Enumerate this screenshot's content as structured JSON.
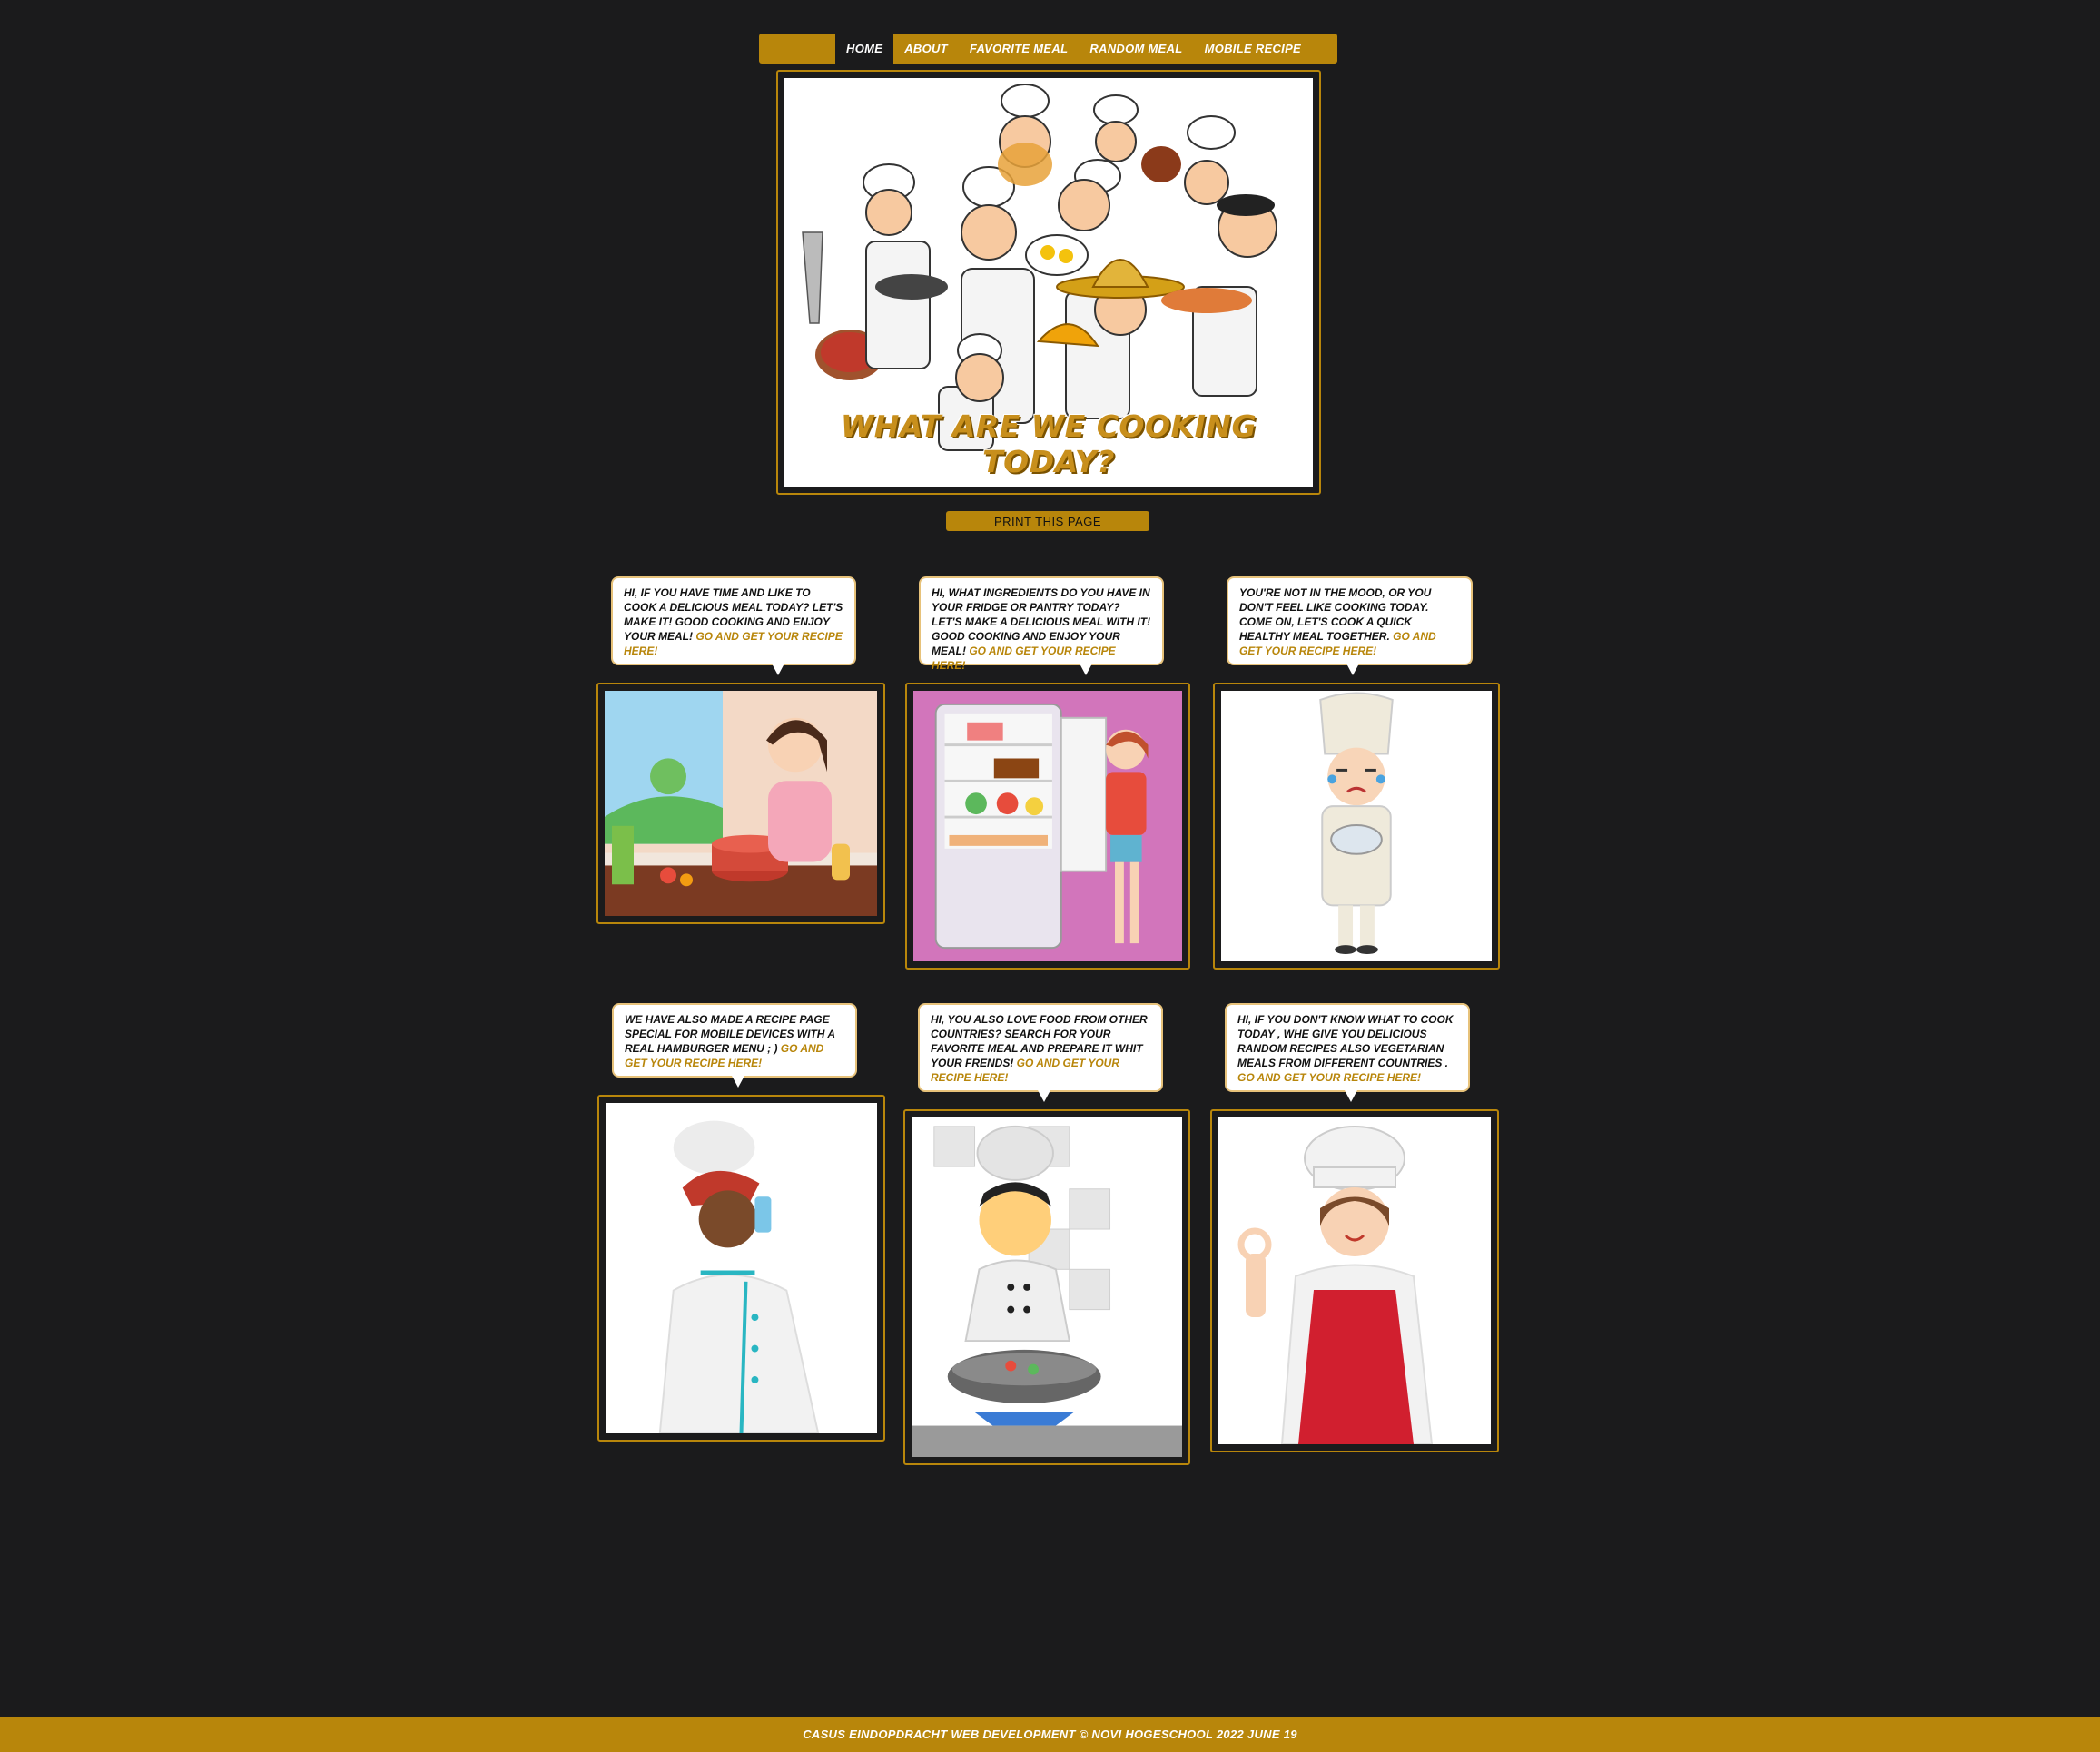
{
  "nav": {
    "items": [
      {
        "label": "HOME",
        "active": true
      },
      {
        "label": "ABOUT",
        "active": false
      },
      {
        "label": "FAVORITE MEAL",
        "active": false
      },
      {
        "label": "RANDOM MEAL",
        "active": false
      },
      {
        "label": "MOBILE RECIPE",
        "active": false
      }
    ]
  },
  "hero": {
    "title": "WHAT ARE WE COOKING TODAY?"
  },
  "print_button": "PRINT THIS PAGE",
  "cards": [
    {
      "text": "HI, IF YOU HAVE TIME AND LIKE TO COOK A DELICIOUS MEAL TODAY? LET'S MAKE IT! GOOD COOKING AND ENJOY YOUR MEAL! ",
      "link": "GO AND GET YOUR RECIPE HERE!"
    },
    {
      "text": "HI, WHAT INGREDIENTS DO YOU HAVE IN YOUR FRIDGE OR PANTRY TODAY? LET'S MAKE A DELICIOUS MEAL WITH IT! GOOD COOKING AND ENJOY YOUR MEAL! ",
      "link": "GO AND GET YOUR RECIPE HERE!"
    },
    {
      "text": "YOU'RE NOT IN THE MOOD, OR YOU DON'T FEEL LIKE COOKING TODAY. COME ON, LET'S COOK A QUICK HEALTHY MEAL TOGETHER. ",
      "link": "GO AND GET YOUR RECIPE HERE!"
    },
    {
      "text": "WE HAVE ALSO MADE A RECIPE PAGE SPECIAL FOR MOBILE DEVICES WITH A REAL HAMBURGER MENU ; ) ",
      "link": "GO AND GET YOUR RECIPE HERE!"
    },
    {
      "text": "HI, YOU ALSO LOVE FOOD FROM OTHER COUNTRIES? SEARCH FOR YOUR FAVORITE MEAL AND PREPARE IT WHIT YOUR FRENDS! ",
      "link": "GO AND GET YOUR RECIPE HERE!"
    },
    {
      "text": "HI, IF YOU DON'T KNOW WHAT TO COOK TODAY , WHE GIVE YOU DELICIOUS RANDOM RECIPES ALSO VEGETARIAN MEALS FROM DIFFERENT COUNTRIES . ",
      "link": "GO AND GET YOUR RECIPE HERE!"
    }
  ],
  "footer": "CASUS EINDOPDRACHT WEB DEVELOPMENT © NOVI HOGESCHOOL 2022 JUNE 19",
  "colors": {
    "background": "#1b1b1c",
    "accent": "#b8860b",
    "link": "#b8860b"
  }
}
